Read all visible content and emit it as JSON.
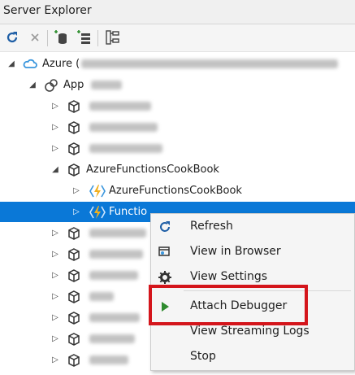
{
  "window": {
    "title": "Server Explorer"
  },
  "toolbar": {
    "buttons": [
      "refresh-icon",
      "stop-icon",
      "connect-database-icon",
      "connect-server-icon",
      "hierarchy-icon"
    ]
  },
  "tree": {
    "azure": {
      "label": "Azure (",
      "icon": "azure-cloud-icon"
    },
    "app_service": {
      "label": "App",
      "icon": "app-service-icon"
    },
    "cookbook": {
      "label": "AzureFunctionsCookBook",
      "icon": "resource-group-icon"
    },
    "cookbook_child": {
      "label": "AzureFunctionsCookBook",
      "icon": "function-app-icon"
    },
    "selected": {
      "label": "Functio",
      "icon": "function-app-icon"
    }
  },
  "context_menu": {
    "items": [
      {
        "label": "Refresh",
        "icon": "refresh-icon"
      },
      {
        "label": "View in Browser",
        "icon": "browser-icon"
      },
      {
        "label": "View Settings",
        "icon": "gear-icon"
      },
      {
        "label": "Attach Debugger",
        "icon": "play-icon"
      },
      {
        "label": "View Streaming Logs",
        "icon": ""
      },
      {
        "label": "Stop",
        "icon": ""
      }
    ]
  },
  "colors": {
    "selection": "#0a78d7",
    "highlight": "#d4151b",
    "play": "#2e8b2e",
    "function_bolt": "#f2b01e",
    "azure": "#3a96dd"
  }
}
